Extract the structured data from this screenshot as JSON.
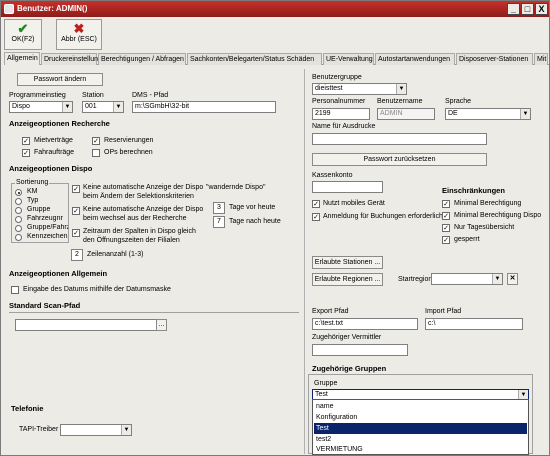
{
  "window": {
    "title": "Benutzer: ADMIN()",
    "buttons": [
      "_",
      "□",
      "X"
    ]
  },
  "toolbar": {
    "ok": "OK(F2)",
    "abbr": "Abbr (ESC)"
  },
  "tabs": [
    "Allgemein",
    "Druckereinstellung",
    "Berechtigungen / Abfragen",
    "Sachkonten/Belegarten/Status Schäden",
    "UE-Verwaltung",
    "Autostartanwendungen",
    "Disposerver-Stationen",
    "Mit..."
  ],
  "left": {
    "passwort_btn": "Passwort ändern",
    "programmeinstieg_label": "Programmeinstieg",
    "programmeinstieg_value": "Dispo",
    "station_label": "Station",
    "station_value": "001",
    "dms_label": "DMS - Pfad",
    "dms_value": "m:\\SGmbH\\32-bit",
    "recherche_title": "Anzeigeoptionen Recherche",
    "mietvertraege": "Mietverträge",
    "reservierungen": "Reservierungen",
    "fahrauftraege": "Fahraufträge",
    "ops": "OPs berechnen",
    "dispo_title": "Anzeigeoptionen Dispo",
    "sortierung_label": "Sortierung",
    "sort_options": [
      "KM",
      "Typ",
      "Gruppe",
      "Fahrzeugnr",
      "Gruppe/Fahrz",
      "Kennzeichen"
    ],
    "opt1": [
      "Keine automatische Anzeige der Dispo",
      "beim Ändern der Selektionskriterien"
    ],
    "opt2": [
      "Keine automatische Anzeige der Dispo",
      "beim wechsel aus der Recherche"
    ],
    "opt3": [
      "Zeitraum der Spalten in Dispo gleich",
      "den Öffnungszeiten der Filialen"
    ],
    "wandernde": "\"wandernde Dispo\"",
    "tage_vor_value": "3",
    "tage_vor": "Tage vor heute",
    "tage_nach_value": "7",
    "tage_nach": "Tage nach heute",
    "zeilen_value": "2",
    "zeilen": "Zeilenanzahl (1-3)",
    "allgemein_title": "Anzeigeoptionen Allgemein",
    "datumsmaske": "Eingabe des Datums mithilfe der Datumsmaske",
    "scan_title": "Standard Scan-Pfad",
    "scan_btn": "...",
    "telefonie_title": "Telefonie",
    "tapi_label": "TAPI-Treiber"
  },
  "right": {
    "benutzergruppe_label": "Benutzergruppe",
    "benutzergruppe_value": "dieisttest",
    "personalnummer_label": "Personalnummer",
    "personalnummer_value": "2199",
    "benutzername_label": "Benutzername",
    "benutzername_value": "ADMIN",
    "sprache_label": "Sprache",
    "sprache_value": "DE",
    "name_ausdrucke_label": "Name für Ausdrucke",
    "name_ausdrucke_value": "",
    "passwort_reset_btn": "Passwort zurücksetzen",
    "kassenkonto_label": "Kassenkonto",
    "einschraenkungen_title": "Einschränkungen",
    "mobil": "Nutzt mobiles Gerät",
    "anmeldung": "Anmeldung für Buchungen erforderlich",
    "minimal": "Minimal Berechtigung",
    "minimal_dispo": "Minimal Berechtigung Dispo",
    "tagesuebersicht": "Nur Tagesübersicht",
    "gesperrt": "gesperrt",
    "erlaubte_stationen_btn": "Erlaubte Stationen ...",
    "erlaubte_regionen_btn": "Erlaubte Regionen ...",
    "startregion_label": "Startregion",
    "export_label": "Export Pfad",
    "export_value": "c:\\test.txt",
    "import_label": "Import Pfad",
    "import_value": "c:\\",
    "vermittler_label": "Zugehöriger Vermittler",
    "gruppen_title": "Zugehörige Gruppen",
    "gruppe_label": "Gruppe",
    "gruppe_value": "Test",
    "gruppen_options": [
      "name",
      "Konfiguration",
      "Test",
      "test2",
      "VERMIETUNG"
    ]
  },
  "colors": {
    "titlebar": "#b52723",
    "selection": "#0a246a"
  }
}
